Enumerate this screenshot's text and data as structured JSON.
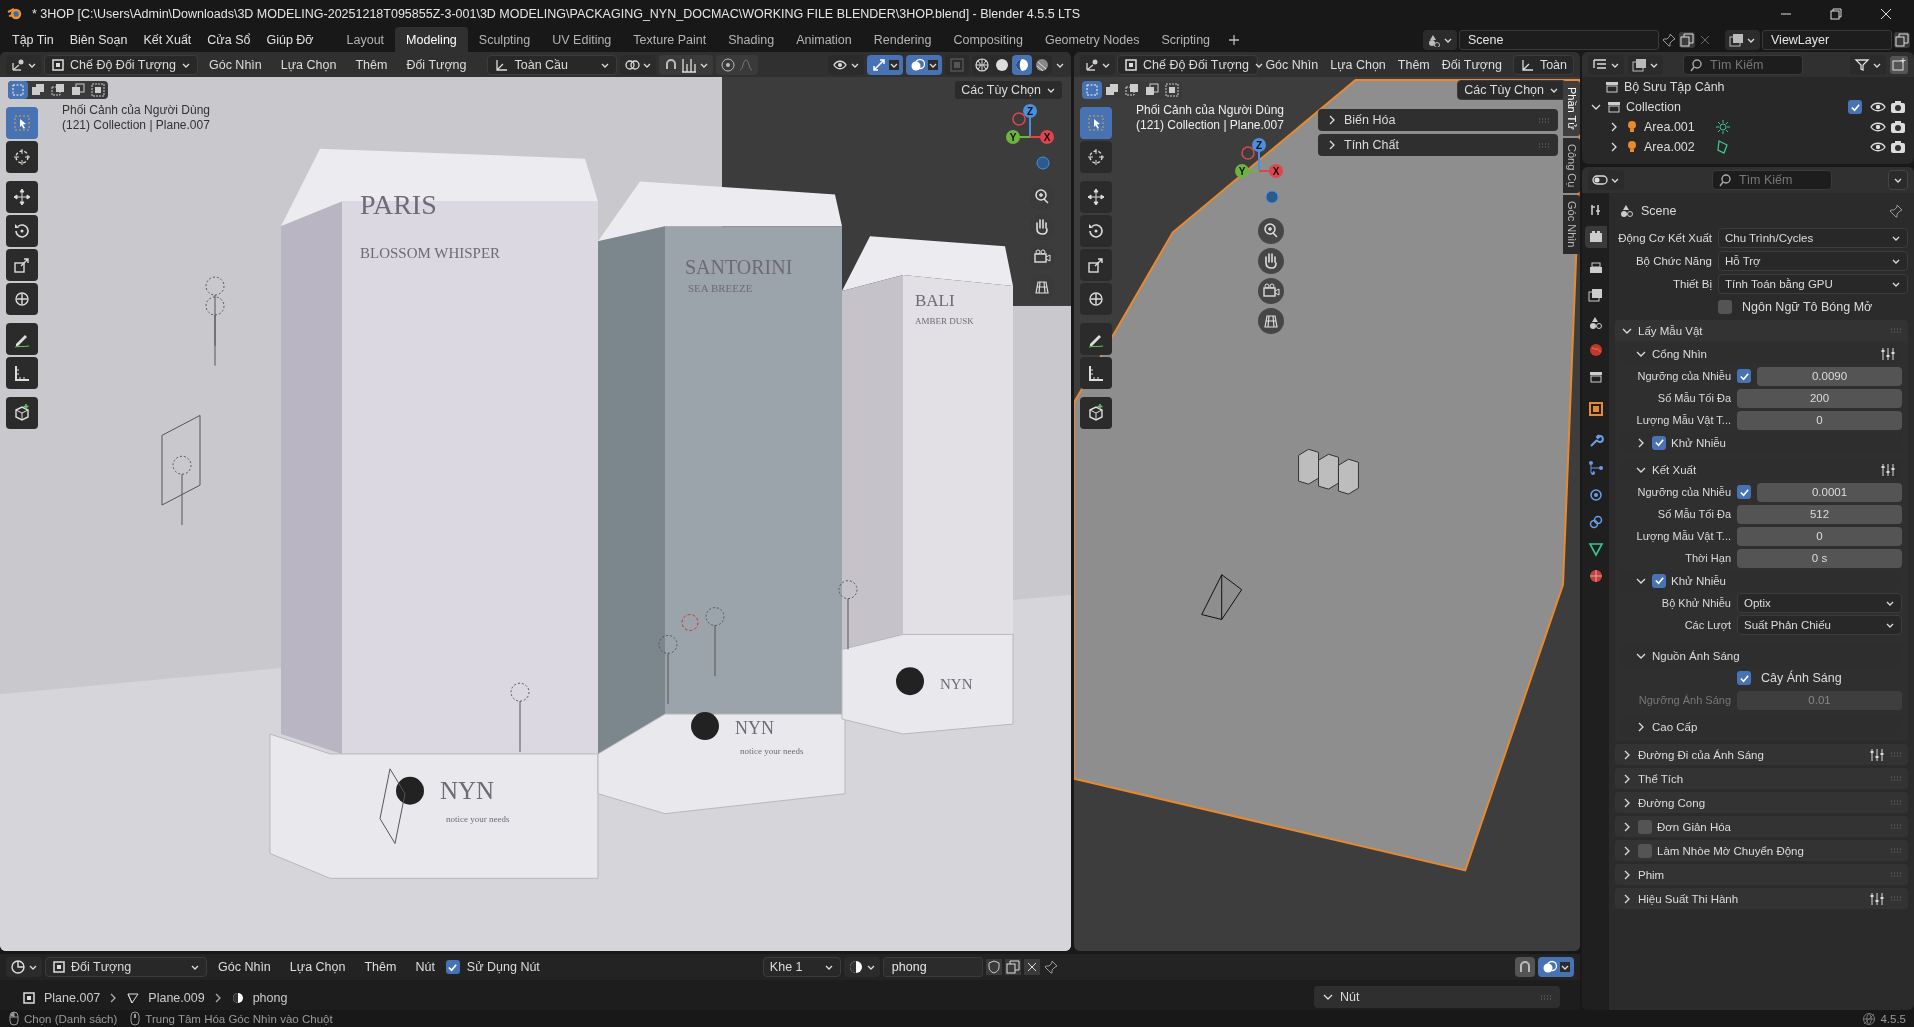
{
  "window": {
    "title": "* 3HOP [C:\\Users\\Admin\\Downloads\\3D MODELING-20251218T095855Z-3-001\\3D MODELING\\PACKAGING_NYN_DOCMAC\\WORKING FILE BLENDER\\3HOP.blend] - Blender 4.5.5 LTS"
  },
  "menu": [
    "Tập Tin",
    "Biên Soạn",
    "Kết Xuất",
    "Cửa Sổ",
    "Giúp Đỡ"
  ],
  "workspaces": [
    {
      "label": "Layout",
      "selected": false
    },
    {
      "label": "Modeling",
      "selected": true
    },
    {
      "label": "Sculpting",
      "selected": false
    },
    {
      "label": "UV Editing",
      "selected": false
    },
    {
      "label": "Texture Paint",
      "selected": false
    },
    {
      "label": "Shading",
      "selected": false
    },
    {
      "label": "Animation",
      "selected": false
    },
    {
      "label": "Rendering",
      "selected": false
    },
    {
      "label": "Compositing",
      "selected": false
    },
    {
      "label": "Geometry Nodes",
      "selected": false
    },
    {
      "label": "Scripting",
      "selected": false
    }
  ],
  "scene": "Scene",
  "view_layer": "ViewLayer",
  "viewports": [
    {
      "kind": "render",
      "mode": "Chế Độ Đối Tượng",
      "menus": [
        "Góc Nhìn",
        "Lựa Chọn",
        "Thêm",
        "Đối Tượng"
      ],
      "orientation": "Toàn Cầu",
      "options": "Các Tùy Chọn",
      "view_name": "Phối Cảnh của Người Dùng",
      "view_info": "(121) Collection | Plane.007",
      "toggles": [
        {
          "kind": "visibility",
          "on": false
        },
        {
          "kind": "gizmo",
          "on": true
        },
        {
          "kind": "overlay",
          "on": true
        }
      ],
      "shading": [
        {
          "kind": "wireframe",
          "selected": false
        },
        {
          "kind": "solid",
          "selected": false
        },
        {
          "kind": "material",
          "selected": true
        },
        {
          "kind": "rendered",
          "selected": false
        }
      ],
      "select_modes": [
        {
          "kind": "new",
          "selected": true
        },
        {
          "kind": "extend",
          "selected": false
        },
        {
          "kind": "subtract",
          "selected": false
        },
        {
          "kind": "invert",
          "selected": false
        },
        {
          "kind": "intersect",
          "selected": false
        }
      ],
      "tools": [
        {
          "kind": "select",
          "selected": true
        },
        {
          "kind": "cursor",
          "selected": false
        },
        {
          "kind": "move",
          "selected": false
        },
        {
          "kind": "rotate",
          "selected": false
        },
        {
          "kind": "scale",
          "selected": false
        },
        {
          "kind": "transform",
          "selected": false
        },
        {
          "kind": "annotate",
          "selected": false
        },
        {
          "kind": "measure",
          "selected": false
        },
        {
          "kind": "add-cube",
          "selected": false
        }
      ],
      "axes": [
        "Z",
        "Y",
        "X"
      ],
      "boxes": [
        {
          "title": "PARIS",
          "subtitle": "BLOSSOM WHISPER",
          "brand": "NYN",
          "tagline": "notice your needs"
        },
        {
          "title": "SANTORINI",
          "subtitle": "SEA BREEZE",
          "brand": "NYN",
          "tagline": "notice your needs"
        },
        {
          "title": "BALI",
          "subtitle": "AMBER DUSK",
          "brand": "NYN"
        }
      ]
    },
    {
      "kind": "layout",
      "mode": "Chế Độ Đối Tượng",
      "menus": [
        "Góc Nhìn",
        "Lựa Chọn",
        "Thêm",
        "Đối Tượng"
      ],
      "orientation": "Toàn",
      "options": "Các Tùy Chọn",
      "view_name": "Phối Cảnh của Người Dùng",
      "view_info": "(121) Collection | Plane.007",
      "select_modes": [
        {
          "kind": "new",
          "selected": true
        },
        {
          "kind": "extend",
          "selected": false
        },
        {
          "kind": "subtract",
          "selected": false
        },
        {
          "kind": "invert",
          "selected": false
        },
        {
          "kind": "intersect",
          "selected": false
        }
      ],
      "tools": [
        {
          "kind": "select",
          "selected": true
        },
        {
          "kind": "cursor",
          "selected": false
        },
        {
          "kind": "move",
          "selected": false
        },
        {
          "kind": "rotate",
          "selected": false
        },
        {
          "kind": "scale",
          "selected": false
        },
        {
          "kind": "transform",
          "selected": false
        },
        {
          "kind": "annotate",
          "selected": false
        },
        {
          "kind": "measure",
          "selected": false
        },
        {
          "kind": "add-cube",
          "selected": false
        }
      ],
      "axes": [
        "Z",
        "Y",
        "X"
      ],
      "side_panels": [
        {
          "title": "Biến Hóa",
          "expanded": false
        },
        {
          "title": "Tính Chất",
          "expanded": false
        }
      ],
      "side_tabs": [
        {
          "label": "Phần Tử",
          "selected": true
        },
        {
          "label": "Công Cụ",
          "selected": false
        },
        {
          "label": "Góc Nhìn",
          "selected": false
        }
      ]
    }
  ],
  "outliner": {
    "search": {
      "placeholder": "Tìm Kiếm"
    },
    "tree": [
      {
        "label": "Bộ Sưu Tập Cảnh",
        "kind": "scene-collection",
        "children": [
          {
            "label": "Collection",
            "kind": "collection",
            "expanded": true,
            "checked": true,
            "children": [
              {
                "label": "Area.001",
                "kind": "sun-light",
                "expanded": false
              },
              {
                "label": "Area.002",
                "kind": "area-light",
                "expanded": false
              }
            ]
          }
        ]
      }
    ]
  },
  "properties": {
    "search": {
      "placeholder": "Tìm Kiếm"
    },
    "context": "Scene",
    "tabs": [
      {
        "kind": "tool",
        "selected": false
      },
      {
        "kind": "render",
        "selected": true
      },
      {
        "kind": "output",
        "selected": false
      },
      {
        "kind": "view-layer",
        "selected": false
      },
      {
        "kind": "scene",
        "selected": false
      },
      {
        "kind": "world",
        "selected": false
      },
      {
        "kind": "collection",
        "selected": false
      },
      {
        "kind": "object",
        "selected": false
      },
      {
        "kind": "modifier",
        "selected": false
      },
      {
        "kind": "particles",
        "selected": false
      },
      {
        "kind": "physics",
        "selected": false
      },
      {
        "kind": "constraints",
        "selected": false
      },
      {
        "kind": "data",
        "selected": false
      },
      {
        "kind": "material",
        "selected": false
      }
    ],
    "items": [
      {
        "kind": "dropdown",
        "label": "Động Cơ Kết Xuất",
        "value": "Chu Trình/Cycles"
      },
      {
        "kind": "dropdown",
        "label": "Bộ Chức Năng",
        "value": "Hỗ Trợ"
      },
      {
        "kind": "dropdown",
        "label": "Thiết Bị",
        "value": "Tính Toán bằng GPU"
      },
      {
        "kind": "checkbox",
        "label": "Ngôn Ngữ Tô Bóng Mở",
        "checked": false
      },
      {
        "kind": "panel",
        "title": "Lấy Mẫu Vật",
        "expanded": true,
        "presets": false,
        "children": [
          {
            "kind": "panel",
            "title": "Cổng Nhìn",
            "expanded": true,
            "presets": true,
            "children": [
              {
                "kind": "number_check",
                "label": "Ngưỡng của Nhiễu",
                "checked": true,
                "value": "0.0090"
              },
              {
                "kind": "number",
                "label": "Số Mẫu Tối Đa",
                "value": "200",
                "disabled": false
              },
              {
                "kind": "number",
                "label": "Lượng Mẫu Vật T...",
                "value": "0",
                "disabled": false
              },
              {
                "kind": "panel",
                "title": "Khử Nhiễu",
                "expanded": false,
                "checked": true,
                "presets": false
              }
            ]
          },
          {
            "kind": "panel",
            "title": "Kết Xuất",
            "expanded": true,
            "presets": true,
            "children": [
              {
                "kind": "number_check",
                "label": "Ngưỡng của Nhiễu",
                "checked": true,
                "value": "0.0001"
              },
              {
                "kind": "number",
                "label": "Số Mẫu Tối Đa",
                "value": "512",
                "disabled": false
              },
              {
                "kind": "number",
                "label": "Lượng Mẫu Vật T...",
                "value": "0",
                "disabled": false
              },
              {
                "kind": "number",
                "label": "Thời Hạn",
                "value": "0 s",
                "disabled": false
              },
              {
                "kind": "panel",
                "title": "Khử Nhiễu",
                "expanded": true,
                "checked": true,
                "presets": false,
                "children": [
                  {
                    "kind": "dropdown",
                    "label": "Bộ Khử Nhiễu",
                    "value": "Optix"
                  },
                  {
                    "kind": "dropdown",
                    "label": "Các Lượt",
                    "value": "Suất Phản Chiếu"
                  }
                ]
              }
            ]
          },
          {
            "kind": "panel",
            "title": "Nguồn Ánh Sáng",
            "expanded": true,
            "presets": false,
            "children": [
              {
                "kind": "checkbox",
                "label": "Cây Ánh Sáng",
                "checked": true
              },
              {
                "kind": "number",
                "label": "Ngưỡng Ánh Sáng",
                "value": "0.01",
                "disabled": true
              }
            ]
          },
          {
            "kind": "panel",
            "title": "Cao Cấp",
            "expanded": false,
            "presets": false
          }
        ]
      },
      {
        "kind": "panel",
        "title": "Đường Đi của Ánh Sáng",
        "expanded": false,
        "presets": true
      },
      {
        "kind": "panel",
        "title": "Thể Tích",
        "expanded": false,
        "presets": false
      },
      {
        "kind": "panel",
        "title": "Đường Cong",
        "expanded": false,
        "presets": false
      },
      {
        "kind": "panel",
        "title": "Đơn Giản Hóa",
        "expanded": false,
        "checked": false,
        "presets": false
      },
      {
        "kind": "panel",
        "title": "Làm Nhòe Mờ Chuyển Động",
        "expanded": false,
        "checked": false,
        "presets": false
      },
      {
        "kind": "panel",
        "title": "Phim",
        "expanded": false,
        "presets": false
      },
      {
        "kind": "panel",
        "title": "Hiệu Suất Thi Hành",
        "expanded": false,
        "presets": true
      }
    ]
  },
  "node_editor": {
    "data_type": "Đối Tượng",
    "menus": [
      "Góc Nhìn",
      "Lựa Chọn",
      "Thêm",
      "Nút"
    ],
    "use_nodes": {
      "label": "Sử Dụng Nút",
      "checked": true
    },
    "slot": "Khe 1",
    "material": "phong",
    "breadcrumb": [
      {
        "kind": "object",
        "label": "Plane.007"
      },
      {
        "kind": "mesh",
        "label": "Plane.009"
      },
      {
        "kind": "material",
        "label": "phong"
      }
    ],
    "sidebar_panel": {
      "title": "Nút",
      "expanded": true
    },
    "overlay_on": true
  },
  "status_bar": {
    "hints": [
      {
        "kind": "mouse-left",
        "label": "Chọn (Danh sách)"
      },
      {
        "kind": "mouse-middle",
        "label": "Trung Tâm Hóa Góc Nhìn vào Chuột"
      }
    ],
    "version": "4.5.5"
  }
}
